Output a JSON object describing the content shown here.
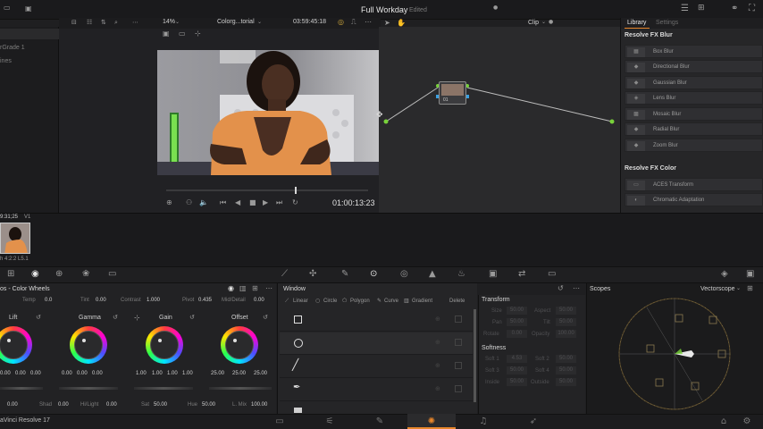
{
  "app": {
    "project_title": "Full Workday",
    "project_status": "Edited",
    "app_name": "aVinci Resolve 17"
  },
  "viewer": {
    "zoom": "14%",
    "timeline_name": "Colorg...torial",
    "source_timecode": "03:59:45:18",
    "playhead_timecode": "01:00:13:23",
    "clip_mode": "Clip"
  },
  "left_panel": {
    "items": [
      "rGrade 1",
      "ines"
    ]
  },
  "node": {
    "label": "01"
  },
  "library": {
    "tab_library": "Library",
    "tab_settings": "Settings",
    "group_blur": "Resolve FX Blur",
    "blur_items": [
      "Box Blur",
      "Directional Blur",
      "Gaussian Blur",
      "Lens Blur",
      "Mosaic Blur",
      "Radial Blur",
      "Zoom Blur"
    ],
    "group_color": "Resolve FX Color",
    "color_items": [
      "ACES Transform",
      "Chromatic Adaptation"
    ]
  },
  "clip_strip": {
    "timecode": "9:31;25",
    "track": "V1",
    "clip_label": "h 4:2:2 L5.1"
  },
  "color_wheels": {
    "panel_title": "os - Color Wheels",
    "temp_label": "Temp",
    "temp_value": "0.0",
    "tint_label": "Tint",
    "tint_value": "0.00",
    "contrast_label": "Contrast",
    "contrast_value": "1.000",
    "pivot_label": "Pivot",
    "pivot_value": "0.435",
    "middetail_label": "Mid/Detail",
    "middetail_value": "0.00",
    "wheels": [
      {
        "name": "Lift",
        "values": [
          "0.00",
          "0.00",
          "0.00"
        ]
      },
      {
        "name": "Gamma",
        "values": [
          "0.00",
          "0.00",
          "0.00"
        ]
      },
      {
        "name": "Gain",
        "values": [
          "1.00",
          "1.00",
          "1.00"
        ]
      },
      {
        "name": "Offset",
        "values": [
          "25.00",
          "25.00",
          "25.00"
        ]
      }
    ],
    "bottom": {
      "shad_label": "Shad",
      "shad_value": "0.00",
      "hilight_label": "Hi/Light",
      "hilight_value": "0.00",
      "sat_label": "Sat",
      "sat_value": "50.00",
      "hue_label": "Hue",
      "hue_value": "50.00",
      "lmix_label": "L. Mix",
      "lmix_value": "100.00",
      "first_value": "0.00"
    }
  },
  "window_panel": {
    "title": "Window",
    "tools": [
      "Linear",
      "Circle",
      "Polygon",
      "Curve",
      "Gradient"
    ],
    "delete_label": "Delete"
  },
  "transform": {
    "title": "Transform",
    "size_label": "Size",
    "size_value": "50.00",
    "aspect_label": "Aspect",
    "aspect_value": "50.00",
    "pan_label": "Pan",
    "pan_value": "50.00",
    "tilt_label": "Tilt",
    "tilt_value": "50.00",
    "rotate_label": "Rotate",
    "rotate_value": "0.00",
    "opacity_label": "Opacity",
    "opacity_value": "100.00",
    "softness_title": "Softness",
    "soft1_label": "Soft 1",
    "soft1_value": "4.53",
    "soft2_label": "Soft 2",
    "soft2_value": "50.00",
    "soft3_label": "Soft 3",
    "soft3_value": "50.00",
    "soft4_label": "Soft 4",
    "soft4_value": "50.00",
    "inside_label": "Inside",
    "inside_value": "50.00",
    "outside_label": "Outside",
    "outside_value": "50.00"
  },
  "scopes": {
    "title": "Scopes",
    "mode": "Vectorscope"
  },
  "colors": {
    "background": "#1f1f21",
    "accent_orange": "#e8862a",
    "node_green": "#78d23a"
  }
}
